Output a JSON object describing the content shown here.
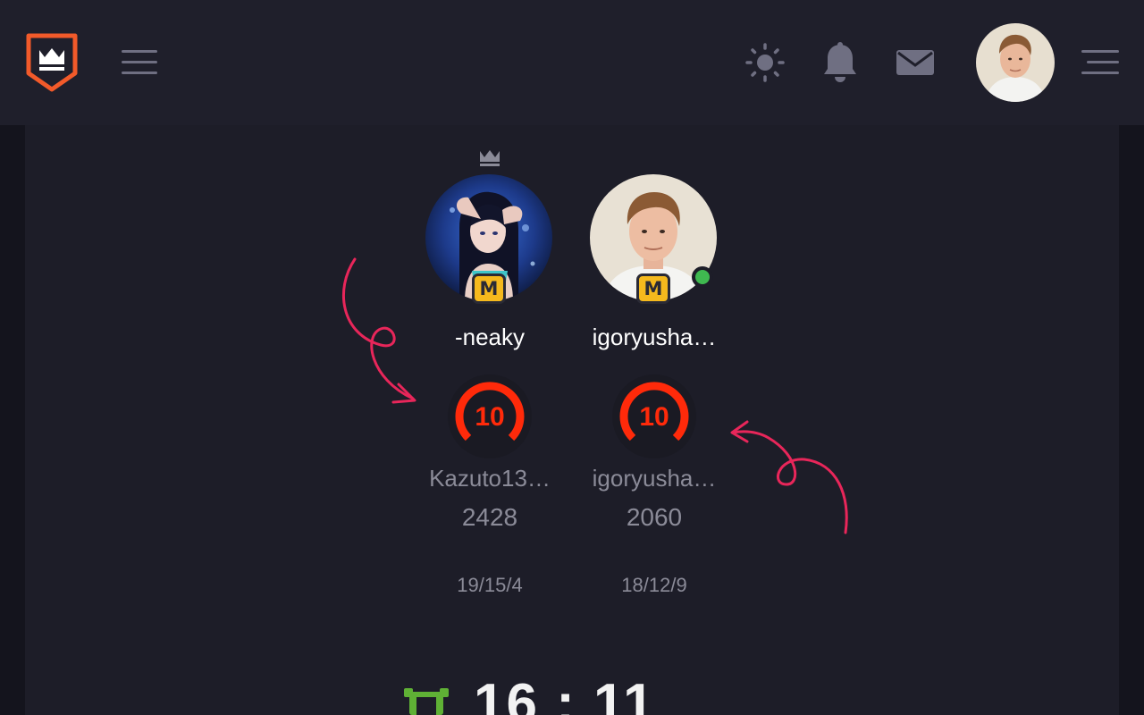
{
  "header": {
    "logo_icon": "shield-crown-logo",
    "icons": [
      "menu-icon",
      "sun-icon",
      "bell-icon",
      "mail-icon",
      "menu-right-icon"
    ],
    "colors": {
      "logo": "#f25a2a",
      "icon": "#6f6f82",
      "bg": "#1f1f2b"
    }
  },
  "players": [
    {
      "name": "-neaky",
      "rank_badge": "M",
      "is_leader": true,
      "level": "10",
      "faceit_name": "Kazuto13…",
      "elo": "2428",
      "kda": "19/15/4"
    },
    {
      "name": "igoryusha…",
      "rank_badge": "M",
      "online": true,
      "level": "10",
      "faceit_name": "igoryusha…",
      "elo": "2060",
      "kda": "18/12/9"
    }
  ],
  "match": {
    "score": "16 : 11",
    "team_icon": "team-icon",
    "team_color": "#5fb135"
  },
  "colors": {
    "level_ring": "#ff2a0a",
    "annotation_arrow": "#e8265a",
    "rank_badge": "#f5b91d",
    "online": "#3fb950"
  }
}
